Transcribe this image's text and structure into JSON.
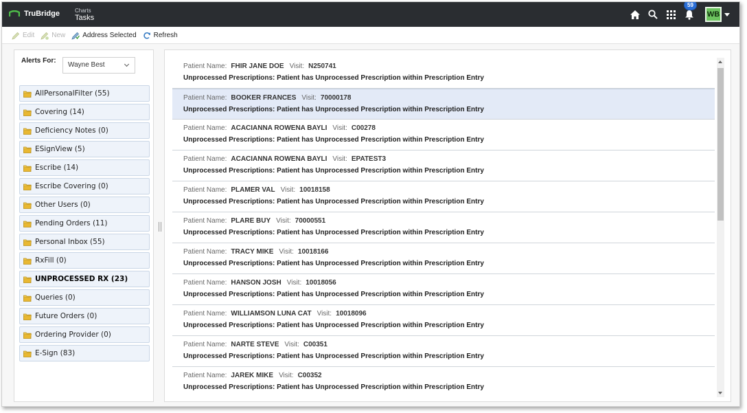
{
  "header": {
    "logo_text": "TruBridge",
    "app_subtitle": "Charts",
    "app_title": "Tasks",
    "notification_count": "59",
    "user_initials": "WB"
  },
  "toolbar": {
    "edit_label": "Edit",
    "new_label": "New",
    "address_selected_label": "Address Selected",
    "refresh_label": "Refresh"
  },
  "filters": {
    "alerts_for_label": "Alerts For:",
    "selected_user": "Wayne Best"
  },
  "folders": [
    {
      "label": "AllPersonalFilter (55)"
    },
    {
      "label": "Covering (14)"
    },
    {
      "label": "Deficiency Notes (0)"
    },
    {
      "label": "ESignView (5)"
    },
    {
      "label": "Escribe (14)"
    },
    {
      "label": "Escribe Covering (0)"
    },
    {
      "label": "Other Users (0)"
    },
    {
      "label": "Pending Orders (11)"
    },
    {
      "label": "Personal Inbox (55)"
    },
    {
      "label": "RxFill (0)"
    },
    {
      "label": "UNPROCESSED RX (23)"
    },
    {
      "label": "Queries (0)"
    },
    {
      "label": "Future Orders (0)"
    },
    {
      "label": "Ordering Provider (0)"
    },
    {
      "label": "E-Sign (83)"
    }
  ],
  "list": {
    "patient_name_label": "Patient Name:",
    "visit_label": "Visit:",
    "rows": [
      {
        "patient": "FHIR JANE DOE",
        "visit": "N250741",
        "message": "Unprocessed Prescriptions: Patient has Unprocessed Prescription within Prescription Entry"
      },
      {
        "patient": "BOOKER FRANCES",
        "visit": "70000178",
        "message": "Unprocessed Prescriptions: Patient has Unprocessed Prescription within Prescription Entry"
      },
      {
        "patient": "ACACIANNA ROWENA BAYLI",
        "visit": "C00278",
        "message": "Unprocessed Prescriptions: Patient has Unprocessed Prescription within Prescription Entry"
      },
      {
        "patient": "ACACIANNA ROWENA BAYLI",
        "visit": "EPATEST3",
        "message": "Unprocessed Prescriptions: Patient has Unprocessed Prescription within Prescription Entry"
      },
      {
        "patient": "PLAMER VAL",
        "visit": "10018158",
        "message": "Unprocessed Prescriptions: Patient has Unprocessed Prescription within Prescription Entry"
      },
      {
        "patient": "PLARE BUY",
        "visit": "70000551",
        "message": "Unprocessed Prescriptions: Patient has Unprocessed Prescription within Prescription Entry"
      },
      {
        "patient": "TRACY MIKE",
        "visit": "10018166",
        "message": "Unprocessed Prescriptions: Patient has Unprocessed Prescription within Prescription Entry"
      },
      {
        "patient": "HANSON JOSH",
        "visit": "10018056",
        "message": "Unprocessed Prescriptions: Patient has Unprocessed Prescription within Prescription Entry"
      },
      {
        "patient": "WILLIAMSON LUNA CAT",
        "visit": "10018096",
        "message": "Unprocessed Prescriptions: Patient has Unprocessed Prescription within Prescription Entry"
      },
      {
        "patient": "NARTE STEVE",
        "visit": "C00351",
        "message": "Unprocessed Prescriptions: Patient has Unprocessed Prescription within Prescription Entry"
      },
      {
        "patient": "JAREK MIKE",
        "visit": "C00352",
        "message": "Unprocessed Prescriptions: Patient has Unprocessed Prescription within Prescription Entry"
      }
    ]
  },
  "colors": {
    "header_bg": "#2a2d31",
    "accent_green": "#6cc35f",
    "badge_blue": "#2b6fd6",
    "selected_row_bg": "#e3eaf7",
    "folder_bg": "#eef3fa"
  }
}
